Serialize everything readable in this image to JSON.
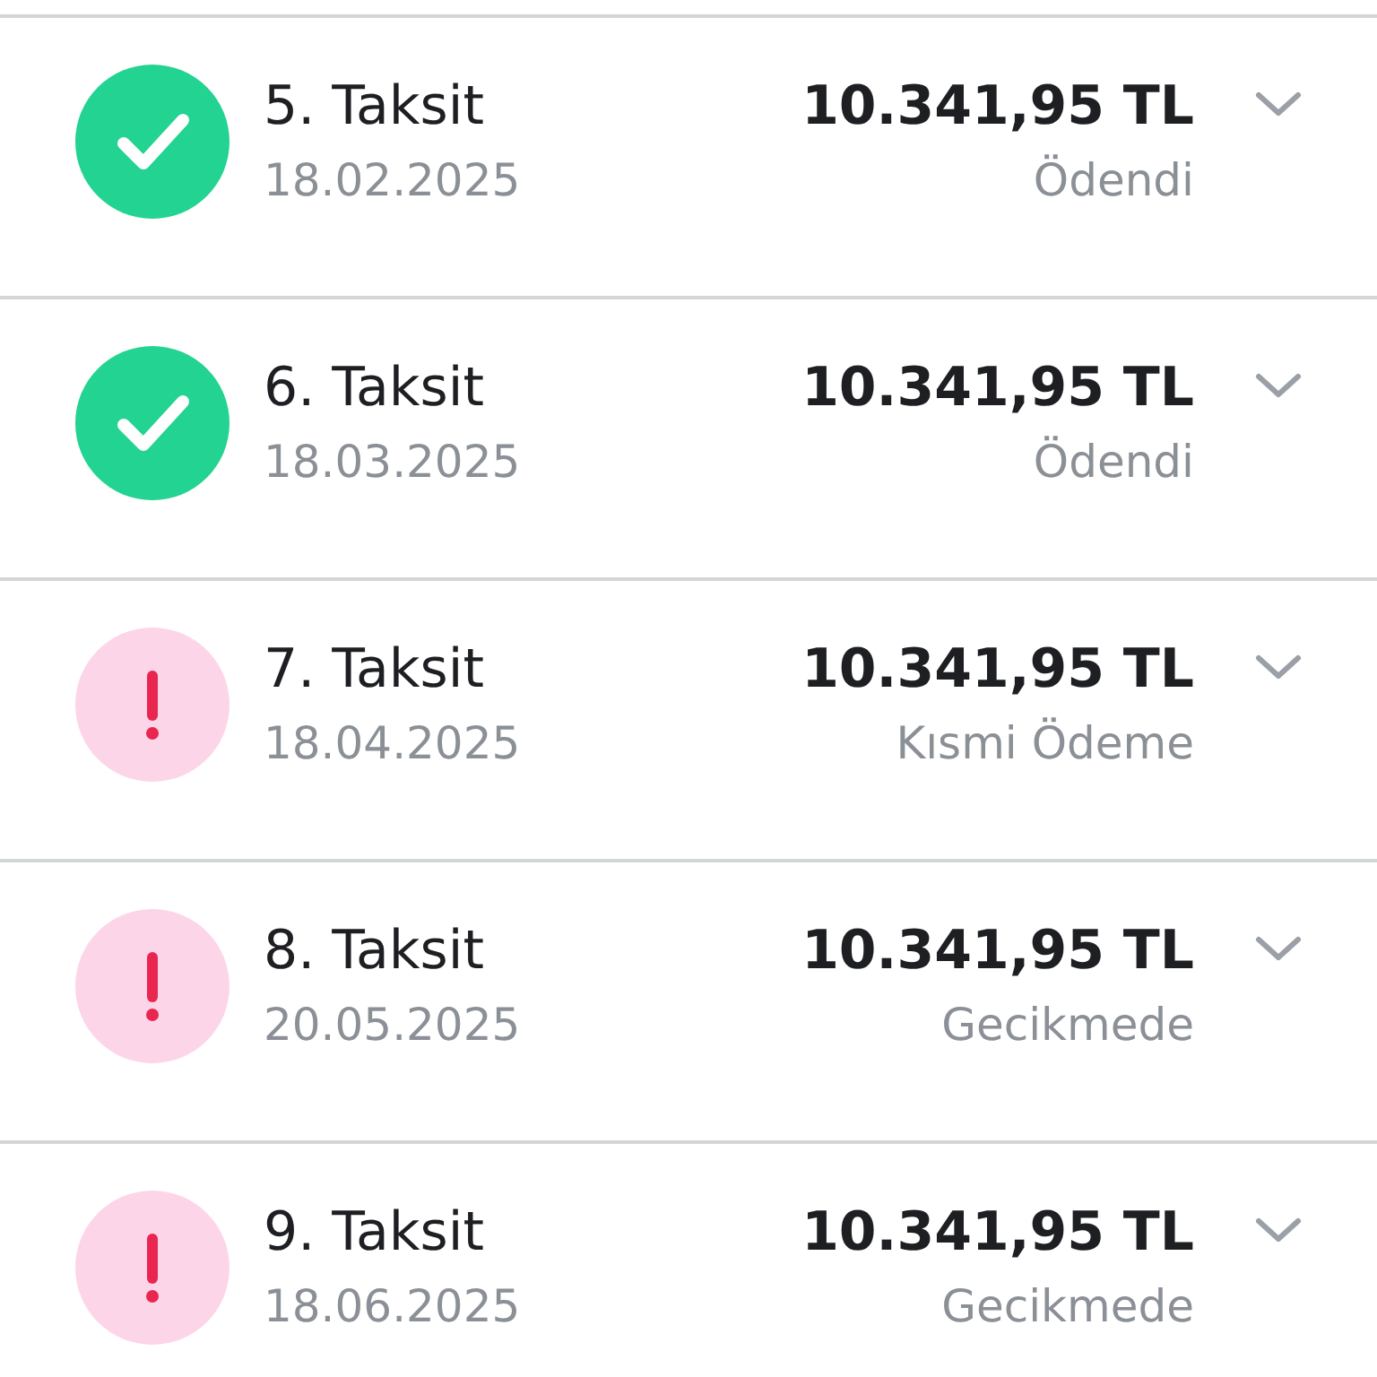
{
  "installments": [
    {
      "title": "5. Taksit",
      "date": "18.02.2025",
      "amount": "10.341,95 TL",
      "status": "Ödendi",
      "kind": "paid",
      "expanded": false
    },
    {
      "title": "6. Taksit",
      "date": "18.03.2025",
      "amount": "10.341,95 TL",
      "status": "Ödendi",
      "kind": "paid",
      "expanded": false
    },
    {
      "title": "7. Taksit",
      "date": "18.04.2025",
      "amount": "10.341,95 TL",
      "status": "Kısmi Ödeme",
      "kind": "alert",
      "expanded": false
    },
    {
      "title": "8. Taksit",
      "date": "20.05.2025",
      "amount": "10.341,95 TL",
      "status": "Gecikmede",
      "kind": "alert",
      "expanded": false
    },
    {
      "title": "9. Taksit",
      "date": "18.06.2025",
      "amount": "10.341,95 TL",
      "status": "Gecikmede",
      "kind": "alert",
      "expanded": false
    }
  ]
}
